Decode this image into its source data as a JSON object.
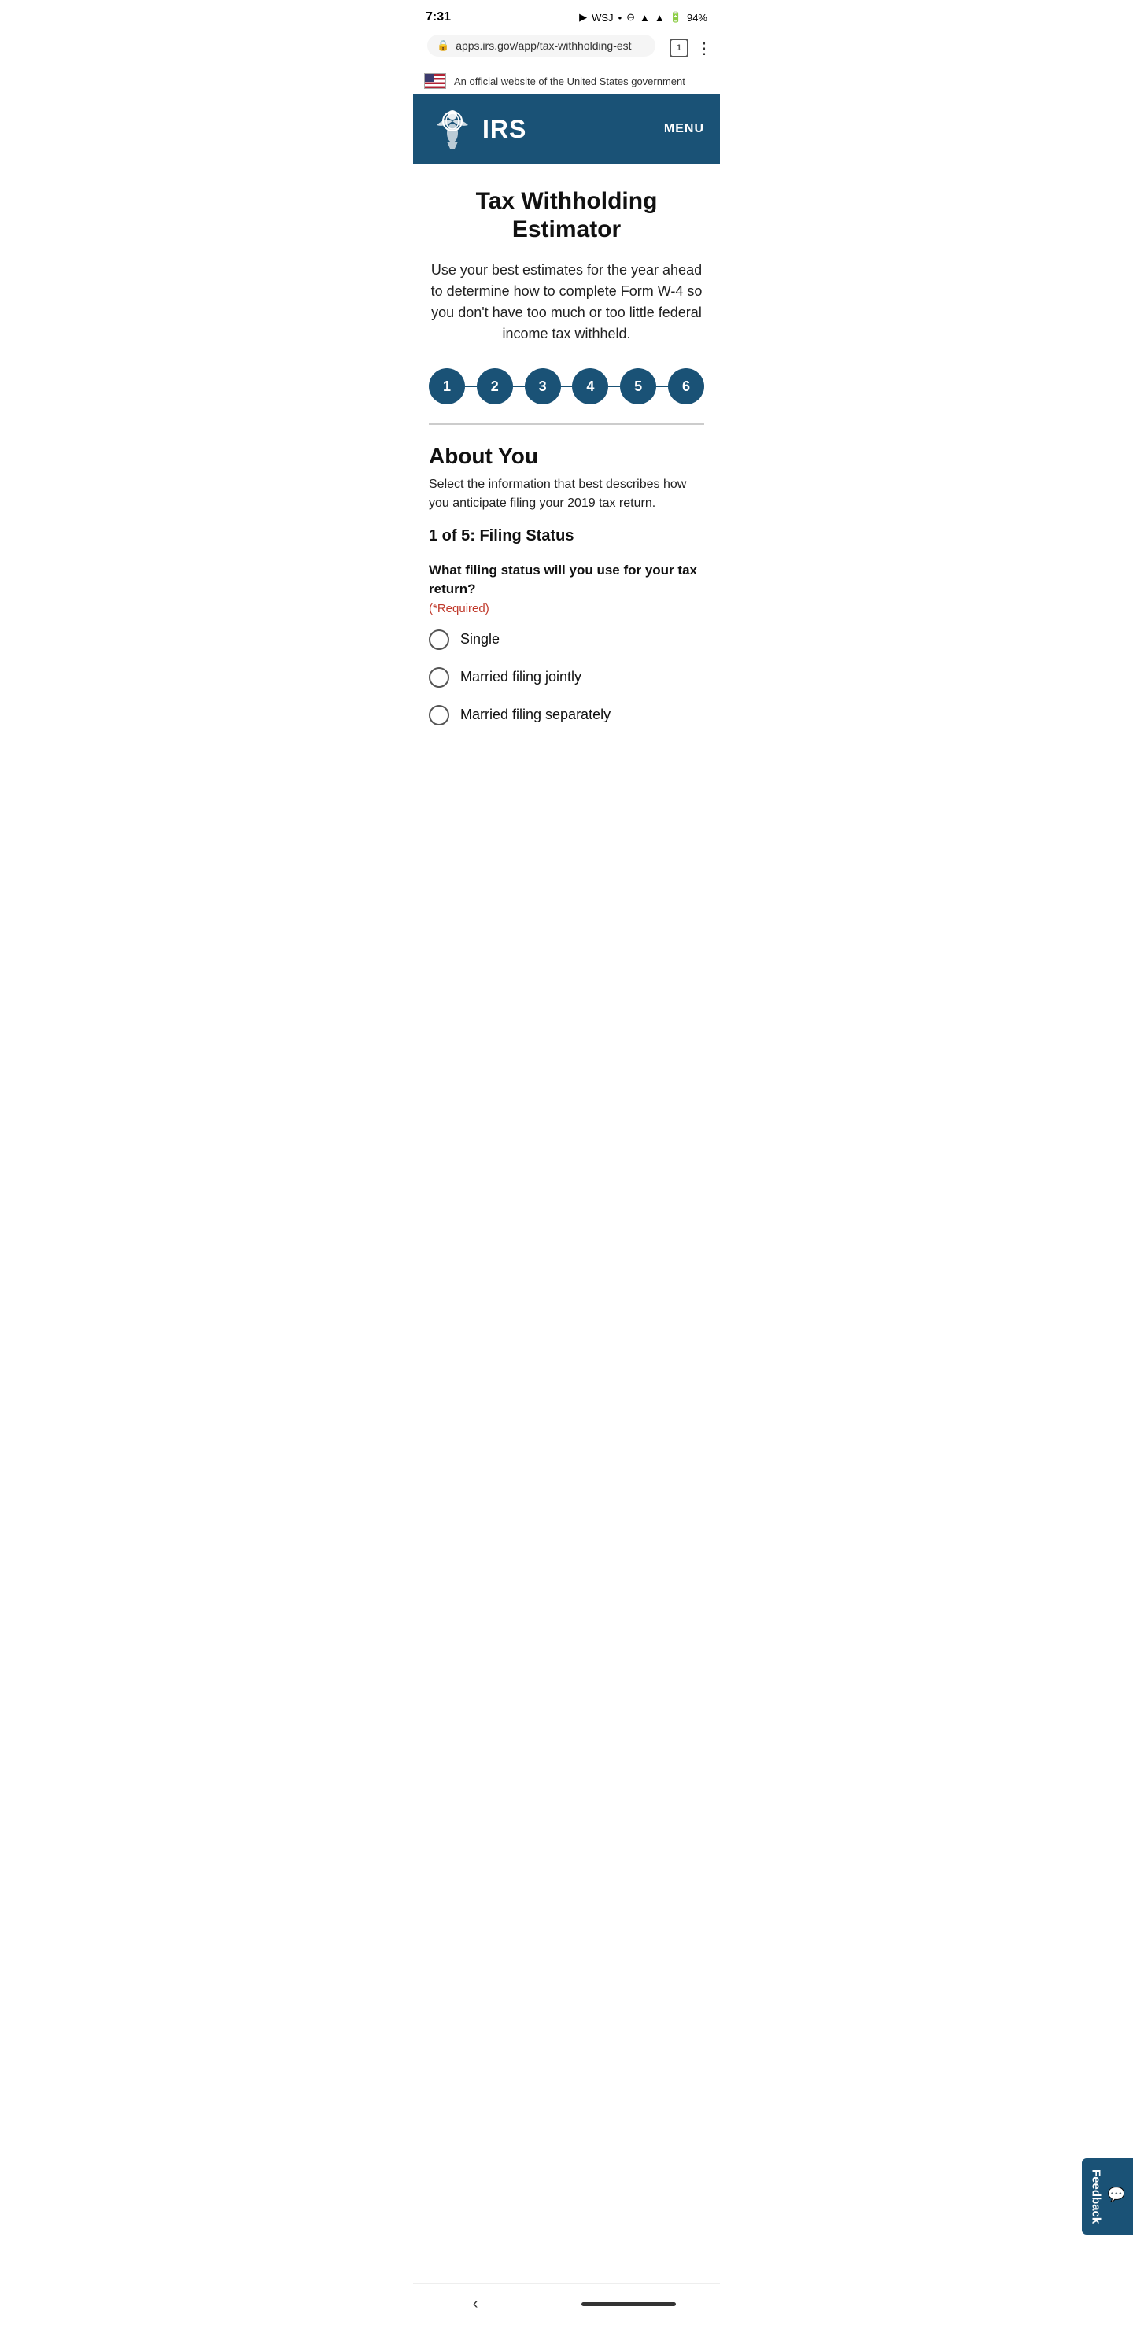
{
  "statusBar": {
    "time": "7:31",
    "battery": "94%"
  },
  "addressBar": {
    "url": "apps.irs.gov/app/tax-withholding-est",
    "tabCount": "1"
  },
  "govBanner": {
    "text": "An official website of the United States government"
  },
  "header": {
    "logoText": "IRS",
    "menuLabel": "MENU"
  },
  "hero": {
    "title": "Tax Withholding Estimator",
    "subtitle": "Use your best estimates for the year ahead to determine how to complete Form W-4 so you don't have too much or too little federal income tax withheld."
  },
  "steps": [
    {
      "number": "1"
    },
    {
      "number": "2"
    },
    {
      "number": "3"
    },
    {
      "number": "4"
    },
    {
      "number": "5"
    },
    {
      "number": "6"
    }
  ],
  "aboutYou": {
    "sectionTitle": "About You",
    "sectionDesc": "Select the information that best describes how you anticipate filing your 2019 tax return.",
    "subTitle": "1 of 5: Filing Status",
    "questionText": "What filing status will you use for your tax return?",
    "requiredText": "(*Required)",
    "options": [
      {
        "label": "Single"
      },
      {
        "label": "Married filing jointly"
      },
      {
        "label": "Married filing separately"
      }
    ]
  },
  "feedback": {
    "label": "Feedback"
  }
}
